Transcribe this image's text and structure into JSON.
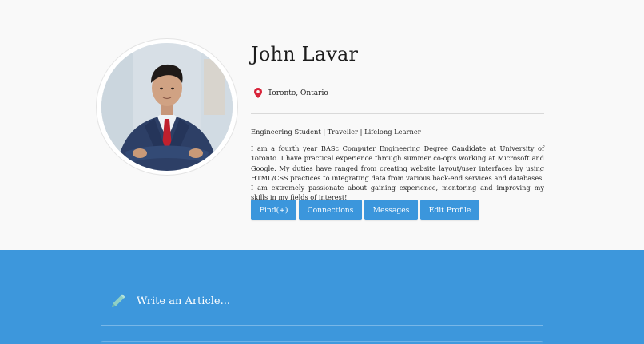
{
  "profile": {
    "name": "John Lavar",
    "location": "Toronto, Ontario",
    "tagline": "Engineering Student | Traveller | Lifelong Learner",
    "bio": "I am a fourth year BASc Computer Engineering Degree Candidate at University of Toronto. I have practical experience through summer co-op's working at Microsoft and Google. My duties have ranged from creating website layout/user interfaces by using HTML/CSS practices to integrating data from various back-end services and databases. I am extremely passionate about gaining experience, mentoring and improving my skills in my fields of interest!",
    "icons": {
      "location": "map-pin-icon"
    }
  },
  "actions": {
    "find_label": "Find(+)",
    "connections_label": "Connections",
    "messages_label": "Messages",
    "edit_profile_label": "Edit Profile"
  },
  "feed": {
    "compose_label": "Write an Article...",
    "icons": {
      "compose": "pencil-icon"
    }
  },
  "colors": {
    "accent": "#3b96dc",
    "feed_background": "#3d97dc",
    "page_background": "#f9f9f9",
    "pin": "#d8243a",
    "pencil": "#8fd0c6"
  }
}
